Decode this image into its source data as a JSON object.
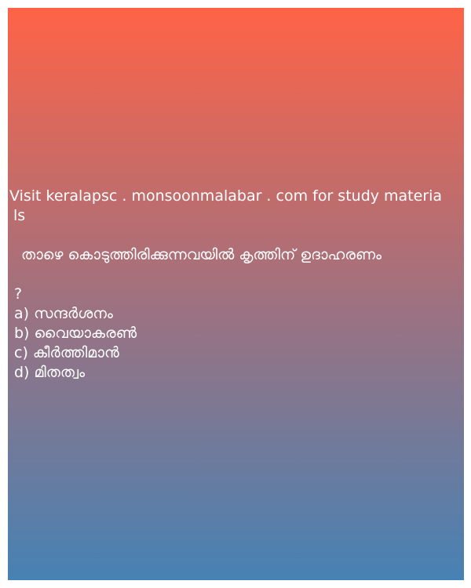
{
  "promo": {
    "line1": "Visit keralapsc . monsoonmalabar . com for study materia",
    "line2": "ls"
  },
  "question": {
    "text": "താഴെ കൊടുത്തിരിക്കുന്നവയിൽ കൃത്തിന് ഉദാഹരണം",
    "mark": "?"
  },
  "options": [
    "a) സന്ദർശനം",
    "b) വൈയാകരൺ",
    "c) കീർത്തിമാൻ",
    "d) മിതത്വം"
  ],
  "colors": {
    "gradient_top": "#ff6347",
    "gradient_bottom": "#4682b4",
    "text": "#ffffff"
  }
}
